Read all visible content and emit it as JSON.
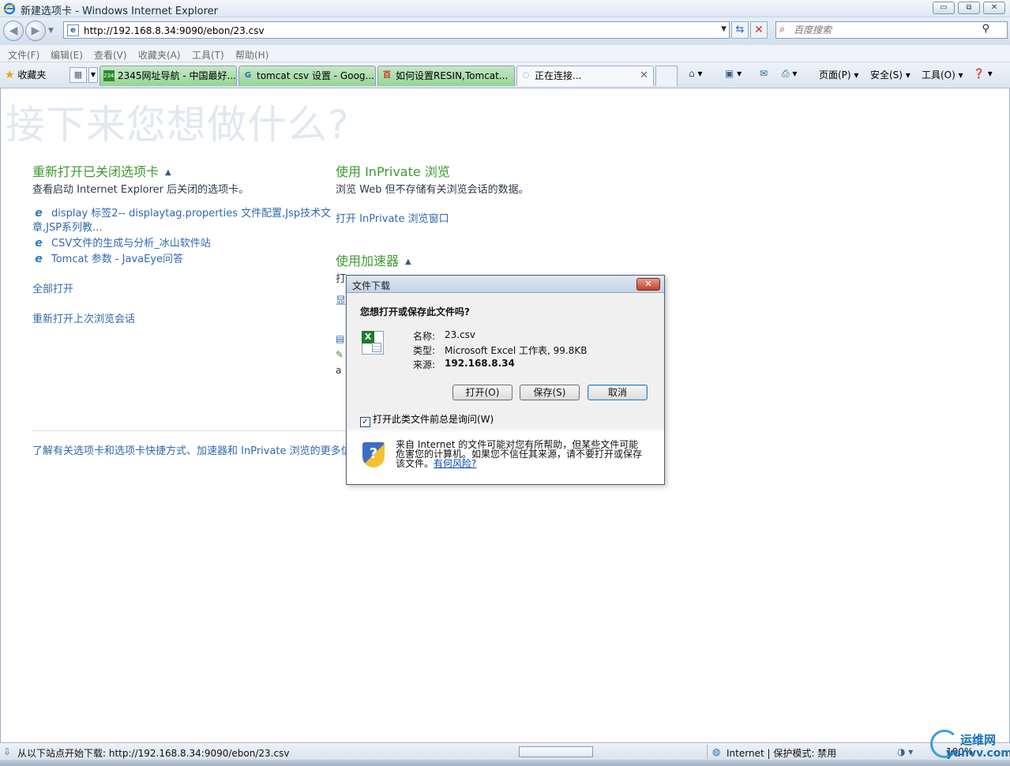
{
  "window": {
    "title": "新建选项卡 - Windows Internet Explorer",
    "controls": [
      "▭",
      "⧉",
      "✕"
    ]
  },
  "address": {
    "url": "http://192.168.8.34:9090/ebon/23.csv",
    "search_placeholder": "百度搜索"
  },
  "menu": [
    "文件(F)",
    "编辑(E)",
    "查看(V)",
    "收藏夹(A)",
    "工具(T)",
    "帮助(H)"
  ],
  "tabbar": {
    "favorites": "收藏夹",
    "tabs": [
      {
        "label": "2345网址导航 - 中国最好...",
        "icon": "2345"
      },
      {
        "label": "tomcat csv 设置 - Goog...",
        "icon": "G"
      },
      {
        "label": "如何设置RESIN,Tomcat...",
        "icon": "百"
      },
      {
        "label": "正在连接...",
        "icon": "◌"
      }
    ],
    "commands": {
      "page": "页面(P) ▾",
      "safety": "安全(S) ▾",
      "tools": "工具(O) ▾"
    }
  },
  "page": {
    "heading": "接下来您想做什么?",
    "reopen": {
      "title": "重新打开已关闭选项卡",
      "desc": "查看启动 Internet Explorer 后关闭的选项卡。",
      "links": [
        "display 标签2-- displaytag.properties 文件配置,Jsp技术文",
        "章,JSP系列教...",
        "CSV文件的生成与分析_冰山软件站",
        "Tomcat 参数 - JavaEye问答"
      ],
      "open_all": "全部打开",
      "reopen_session": "重新打开上次浏览会话"
    },
    "inprivate": {
      "title": "使用 InPrivate 浏览",
      "desc": "浏览 Web 但不存储有关浏览会话的数据。",
      "link": "打开 InPrivate 浏览窗口"
    },
    "accelerators": {
      "title": "使用加速器",
      "desc_partial": "打",
      "link_partial": "显"
    },
    "footer_link": "了解有关选项卡和选项卡快捷方式、加速器和 InPrivate 浏览的更多信"
  },
  "dialog": {
    "title": "文件下载",
    "question": "您想打开或保存此文件吗?",
    "name_label": "名称:",
    "name_value": "23.csv",
    "type_label": "类型:",
    "type_value": "Microsoft Excel 工作表, 99.8KB",
    "from_label": "来源:",
    "from_value": "192.168.8.34",
    "open_btn": "打开(O)",
    "save_btn": "保存(S)",
    "cancel_btn": "取消",
    "always_ask": "打开此类文件前总是询问(W)",
    "warning_line1": "来自 Internet 的文件可能对您有所帮助，但某些文件可能",
    "warning_line2": "危害您的计算机。如果您不信任其来源，请不要打开或保存",
    "warning_line3": "该文件。",
    "risk_link": "有何风险?"
  },
  "status": {
    "text": "从以下站点开始下载: http://192.168.8.34:9090/ebon/23.csv",
    "zone": "Internet | 保护模式: 禁用",
    "zoom": "100%"
  },
  "watermark": {
    "line1": "运维网",
    "line2": "yunvv.com"
  }
}
